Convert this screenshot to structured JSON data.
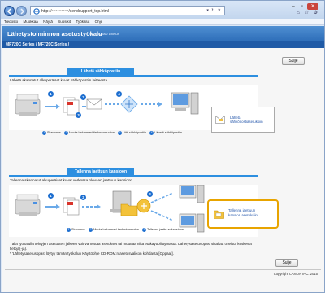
{
  "browser": {
    "url": "http://••••••••••••/sendsupport_top.html",
    "menu": [
      "Tiedosto",
      "Muokkaa",
      "Näytä",
      "Suosikit",
      "Työkalut",
      "Ohje"
    ]
  },
  "header": {
    "title": "Lähetystoiminnon asetustyökalu",
    "link": "Katso asetus",
    "breadcrumb": "MF720C Series / MF720C Series /"
  },
  "top_button": "Sulje",
  "bottom_button": "Sulje",
  "email_section": {
    "title": "Lähetä sähköpostiin",
    "description": "Lähetä skannatut alkuperäiset kuvat sähköpostiin laitteesta.",
    "step_numbers": [
      "1",
      "2",
      "3",
      "4"
    ],
    "steps": [
      "Skannaus",
      "Muuta haluamasi tiedostomuoton",
      "Liitä sähköpostiin",
      "Lähetä sähköpostiin"
    ],
    "action_label": "Lähetä sähköpostiasetuksiin"
  },
  "folder_section": {
    "title": "Tallenna jaettuun kansioon",
    "description": "Tallenna skannatut alkuperäiset kuvat verkossa olevaan jaettuun kansioon.",
    "step_numbers": [
      "1",
      "2",
      "3"
    ],
    "steps": [
      "Skannaus",
      "Muuta haluamasi tiedostomuoton",
      "Tallenna jaettuun kansioon"
    ],
    "action_label_1": "Tallenna jaettuun",
    "action_label_2": "kansion asetuksiin"
  },
  "footer": {
    "line1": "Tällä työkalulla tehtyjen asetusten jälkeen voit vahvistaa asetukset tai muuttaa niitä etäkäyttöliittymästä. Lähetysasetusopas' sisältää oheista koskevia",
    "line2": "tietoja(-ja).",
    "line3": "* 'Lähetysasetusopas' löytyy tämän työkalun Käyttöohje CD-ROM:n asetusvalikon kohdasta [Oppaat].",
    "copyright": "Copyright CANON INC. 2015"
  },
  "colors": {
    "accent": "#2d8fe0",
    "header": "#2f6fba",
    "bar": "#1f5aa6",
    "highlight": "#e8a400"
  }
}
